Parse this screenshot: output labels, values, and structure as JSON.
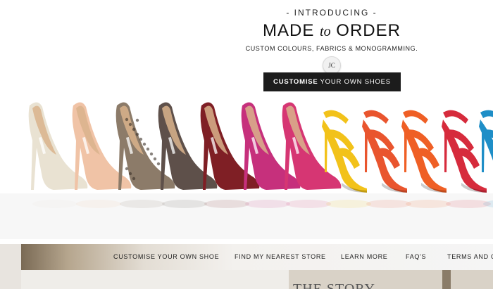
{
  "hero": {
    "intro": "- INTRODUCING -",
    "title_part1": "MADE",
    "title_to": "to",
    "title_part2": "ORDER",
    "subtitle": "CUSTOM COLOURS, FABRICS & MONOGRAMMING.",
    "monogram": "JC",
    "cta_bold": "CUSTOMISE",
    "cta_rest": "YOUR OWN SHOES"
  },
  "shoes": [
    {
      "color": "#e9e2d2",
      "type": "pump"
    },
    {
      "color": "#f0c3a6",
      "type": "pump"
    },
    {
      "color": "#8c7b69",
      "type": "pump-snake"
    },
    {
      "color": "#5e504a",
      "type": "pump"
    },
    {
      "color": "#7f1f25",
      "type": "pump"
    },
    {
      "color": "#c6307c",
      "type": "pump"
    },
    {
      "color": "#d63673",
      "type": "pump"
    },
    {
      "color": "#f2c21a",
      "type": "sandal"
    },
    {
      "color": "#e9552e",
      "type": "sandal"
    },
    {
      "color": "#ef5f25",
      "type": "sandal"
    },
    {
      "color": "#d62b3c",
      "type": "sandal"
    },
    {
      "color": "#1e8ec7",
      "type": "sandal"
    }
  ],
  "nav": {
    "items": [
      "CUSTOMISE YOUR OWN SHOE",
      "FIND MY NEAREST STORE",
      "LEARN MORE",
      "FAQ'S",
      "TERMS AND C"
    ]
  },
  "story": {
    "title": "THE STORY"
  }
}
